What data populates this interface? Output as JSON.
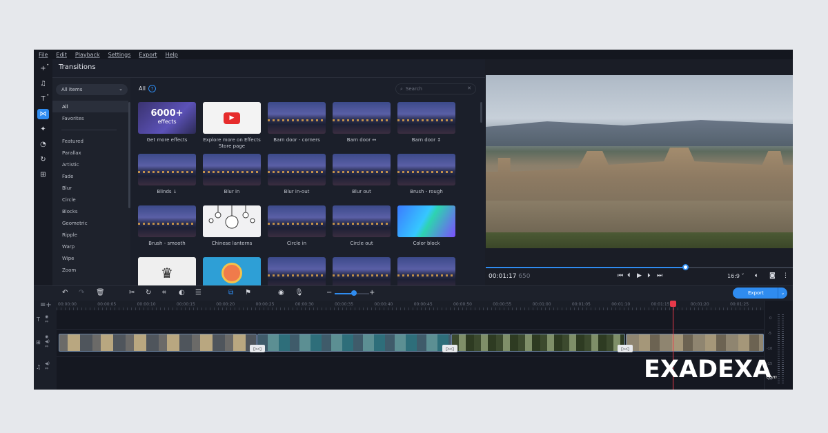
{
  "menu": [
    "File",
    "Edit",
    "Playback",
    "Settings",
    "Export",
    "Help"
  ],
  "rail_icons": [
    "plus-icon",
    "music-icon",
    "text-icon",
    "transitions-icon",
    "sparkle-icon",
    "filter-icon",
    "rotate-icon",
    "stickers-icon"
  ],
  "panel": {
    "title": "Transitions",
    "dropdown": "All items",
    "grid_heading": "All",
    "help_glyph": "?",
    "search_placeholder": "Search",
    "categories": [
      "All",
      "Favorites",
      "Featured",
      "Parallax",
      "Artistic",
      "Fade",
      "Blur",
      "Circle",
      "Blocks",
      "Geometric",
      "Ripple",
      "Warp",
      "Wipe",
      "Zoom"
    ],
    "selected_category": "All"
  },
  "tiles": [
    {
      "label": "Get more effects",
      "kind": "promo",
      "promo_big": "6000+",
      "promo_small": "effects"
    },
    {
      "label": "Explore more on Effects Store page",
      "kind": "store"
    },
    {
      "label": "Barn door - corners",
      "kind": "night"
    },
    {
      "label": "Barn door ↔",
      "kind": "night"
    },
    {
      "label": "Barn door ↕",
      "kind": "night"
    },
    {
      "label": "Blinds ↓",
      "kind": "night"
    },
    {
      "label": "Blur in",
      "kind": "night"
    },
    {
      "label": "Blur in-out",
      "kind": "night"
    },
    {
      "label": "Blur out",
      "kind": "night"
    },
    {
      "label": "Brush - rough",
      "kind": "night"
    },
    {
      "label": "Brush - smooth",
      "kind": "night"
    },
    {
      "label": "Chinese lanterns",
      "kind": "lantern"
    },
    {
      "label": "Circle in",
      "kind": "night"
    },
    {
      "label": "Circle out",
      "kind": "night"
    },
    {
      "label": "Color block",
      "kind": "color"
    },
    {
      "label": "",
      "kind": "chef"
    },
    {
      "label": "",
      "kind": "badge"
    },
    {
      "label": "",
      "kind": "night"
    },
    {
      "label": "",
      "kind": "night"
    },
    {
      "label": "",
      "kind": "night"
    }
  ],
  "player": {
    "timecode": "00:01:17",
    "frames": "650",
    "progress": 0.65,
    "aspect_ratio": "16:9 ˅"
  },
  "timeline": {
    "export_label": "Export",
    "ruler_labels": [
      "00:00:00",
      "00:00:05",
      "00:00:10",
      "00:00:15",
      "00:00:20",
      "00:00:25",
      "00:00:30",
      "00:00:35",
      "00:00:40",
      "00:00:45",
      "00:00:50",
      "00:00:55",
      "00:01:00",
      "00:01:05",
      "00:01:10",
      "00:01:15",
      "00:01:20",
      "00:01:25"
    ],
    "transition_glyph": "▷◁",
    "meter_labels": [
      "0",
      "-5",
      "-10",
      "-15",
      "-20"
    ]
  },
  "watermark": {
    "text": "EXADEXA",
    "sub": "com"
  },
  "colors": {
    "accent": "#2f8cf0",
    "playhead": "#e8394a",
    "app_bg": "#1b1f2a"
  }
}
